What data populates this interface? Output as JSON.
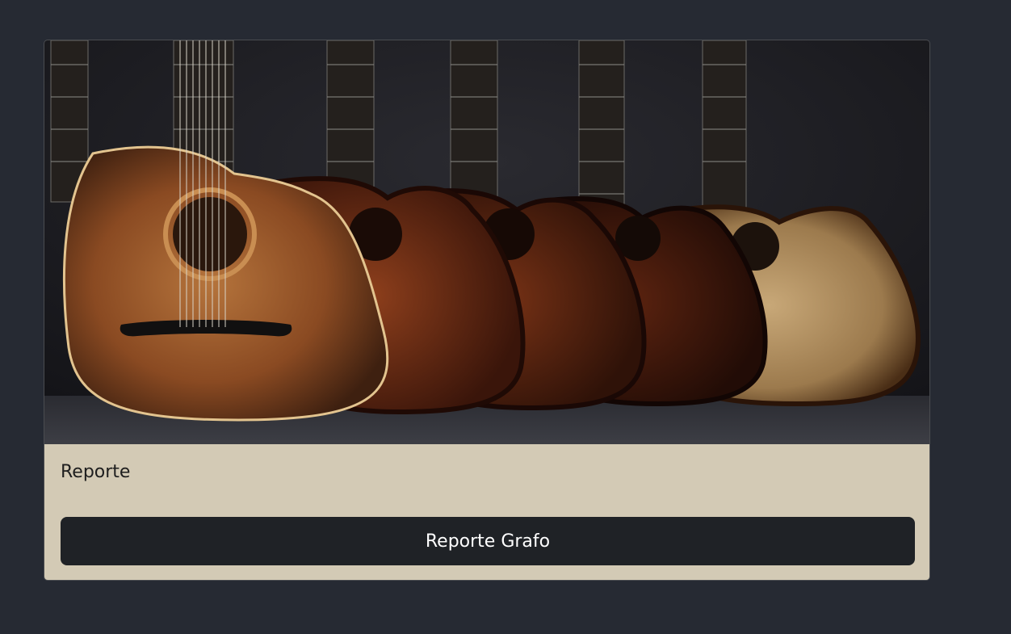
{
  "card": {
    "image_alt": "guitars-image",
    "title": "Reporte",
    "button_label": "Reporte Grafo"
  },
  "colors": {
    "page_background": "#262a33",
    "card_body": "#d3cab5",
    "button": "#1f2226",
    "button_text": "#ffffff"
  }
}
